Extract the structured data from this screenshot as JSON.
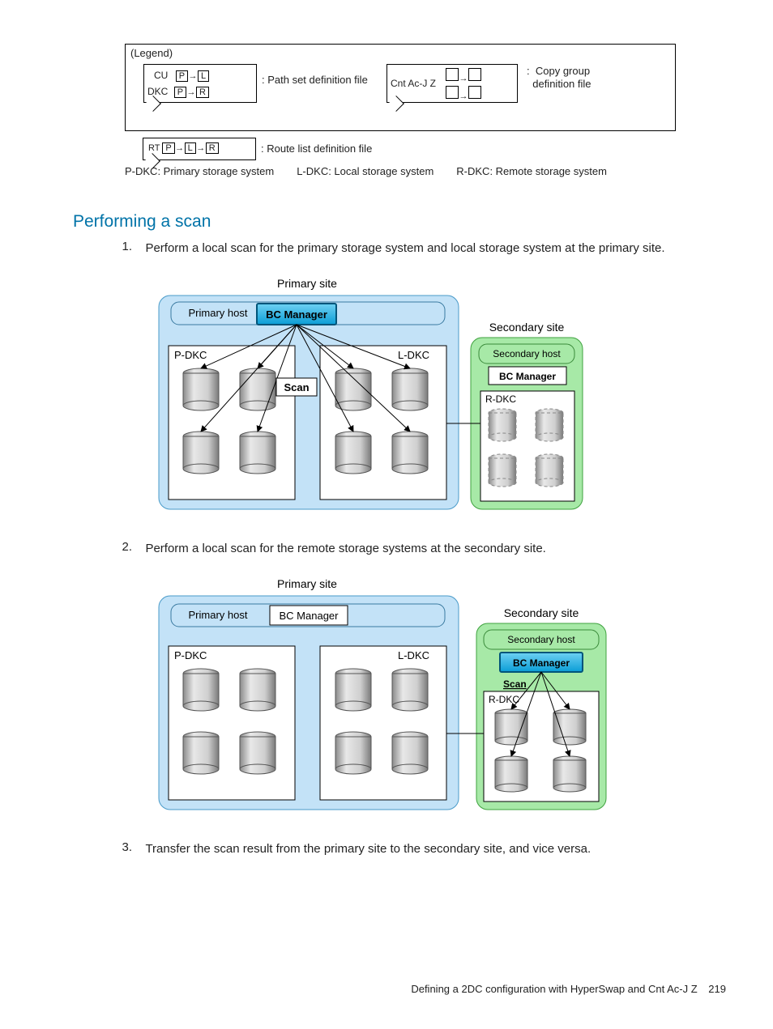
{
  "legend": {
    "title": "(Legend)",
    "cu": "CU",
    "p": "P",
    "l": "L",
    "r": "R",
    "dkc": "DKC",
    "rt": "RT",
    "pathset": ": Path set definition file",
    "routelist": ": Route list definition file",
    "cntacj": "Cnt Ac-J Z",
    "copygroup1": "Copy group",
    "copygroup2": "definition file",
    "colon": ":",
    "pdkc": "P-DKC: Primary storage system",
    "ldkc": "L-DKC: Local storage system",
    "rdkc": "R-DKC: Remote storage system"
  },
  "heading": "Performing a scan",
  "steps": {
    "n1": "1.",
    "t1": "Perform a local scan for the primary storage system and local storage system at the primary site.",
    "n2": "2.",
    "t2": "Perform a local scan for the remote storage systems at the secondary site.",
    "n3": "3.",
    "t3": "Transfer the scan result from the primary site to the secondary site, and vice versa."
  },
  "diag": {
    "primarysite": "Primary site",
    "primaryhost": "Primary host",
    "bcmanager": "BC Manager",
    "pdkc": "P-DKC",
    "ldkc": "L-DKC",
    "scan": "Scan",
    "secondarysite": "Secondary site",
    "secondaryhost": "Secondary host",
    "rdkc": "R-DKC"
  },
  "footer": {
    "text": "Defining a 2DC configuration with HyperSwap and Cnt Ac-J Z",
    "page": "219"
  }
}
